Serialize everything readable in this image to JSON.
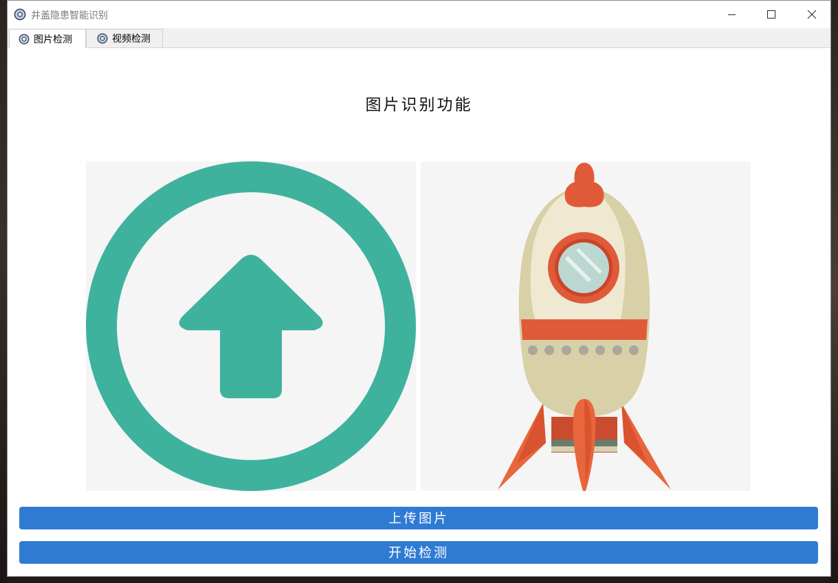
{
  "window": {
    "title": "井盖隐患智能识别",
    "controls": {
      "minimize": "minimize-icon",
      "maximize": "maximize-icon",
      "close": "close-icon"
    }
  },
  "tabs": [
    {
      "label": "图片检测",
      "icon": "app-logo-icon",
      "active": true
    },
    {
      "label": "视频检测",
      "icon": "app-logo-icon",
      "active": false
    }
  ],
  "main": {
    "heading": "图片识别功能",
    "upload_preview": {
      "icon": "upload-arrow-circle-icon",
      "color": "#3fb29e"
    },
    "result_preview": {
      "icon": "rocket-illustration"
    }
  },
  "buttons": {
    "upload_label": "上传图片",
    "detect_label": "开始检测"
  },
  "colors": {
    "accent": "#2f7bd3",
    "upload_icon": "#3fb29e",
    "rocket_red": "#e05a3a"
  }
}
